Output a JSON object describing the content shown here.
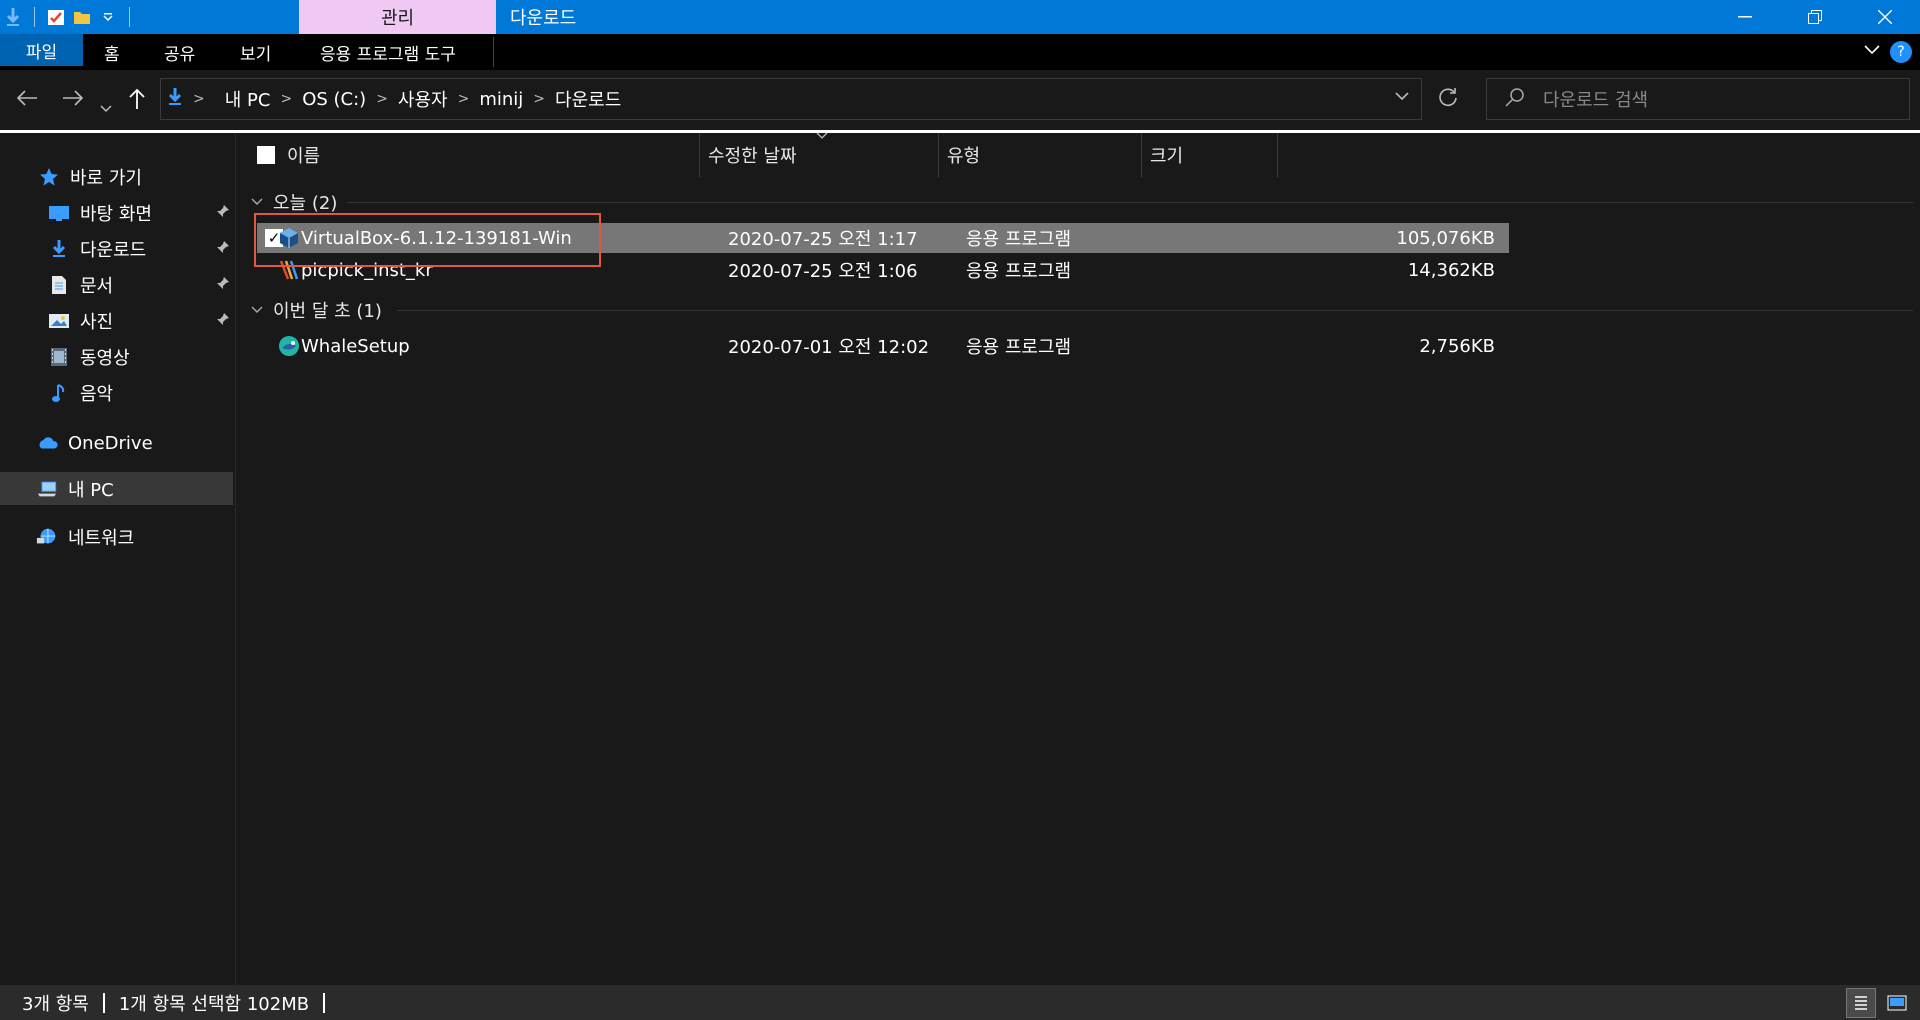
{
  "titlebar": {
    "context_tab": "관리",
    "title": "다운로드",
    "minimize_icon": "minimize-icon",
    "restore_icon": "restore-icon",
    "close_icon": "close-icon"
  },
  "ribbon": {
    "tabs": [
      {
        "label": "파일"
      },
      {
        "label": "홈"
      },
      {
        "label": "공유"
      },
      {
        "label": "보기"
      },
      {
        "label": "응용 프로그램 도구"
      }
    ],
    "help_label": "?"
  },
  "address": {
    "crumbs": [
      "내 PC",
      "OS (C:)",
      "사용자",
      "minij",
      "다운로드"
    ]
  },
  "search": {
    "placeholder": "다운로드 검색"
  },
  "nav": {
    "quick_access": "바로 가기",
    "items": [
      {
        "label": "바탕 화면",
        "icon": "desktop-icon",
        "pinned": true
      },
      {
        "label": "다운로드",
        "icon": "download-icon",
        "pinned": true
      },
      {
        "label": "문서",
        "icon": "document-icon",
        "pinned": true
      },
      {
        "label": "사진",
        "icon": "picture-icon",
        "pinned": true
      },
      {
        "label": "동영상",
        "icon": "video-icon",
        "pinned": false
      },
      {
        "label": "음악",
        "icon": "music-icon",
        "pinned": false
      }
    ],
    "onedrive": "OneDrive",
    "this_pc": "내 PC",
    "network": "네트워크"
  },
  "columns": {
    "name": "이름",
    "date": "수정한 날짜",
    "type": "유형",
    "size": "크기"
  },
  "groups": [
    {
      "label": "오늘 (2)",
      "files": [
        {
          "name": "VirtualBox-6.1.12-139181-Win",
          "date": "2020-07-25 오전 1:17",
          "type": "응용 프로그램",
          "size": "105,076KB",
          "selected": true
        },
        {
          "name": "picpick_inst_kr",
          "date": "2020-07-25 오전 1:06",
          "type": "응용 프로그램",
          "size": "14,362KB",
          "selected": false
        }
      ]
    },
    {
      "label": "이번 달 초 (1)",
      "files": [
        {
          "name": "WhaleSetup",
          "date": "2020-07-01 오전 12:02",
          "type": "응용 프로그램",
          "size": "2,756KB",
          "selected": false
        }
      ]
    }
  ],
  "status": {
    "count": "3개 항목",
    "selection": "1개 항목 선택함 102MB"
  },
  "colors": {
    "accent": "#0078d7",
    "context_tab": "#f0c8f4",
    "selection_outline": "#e2583e"
  }
}
